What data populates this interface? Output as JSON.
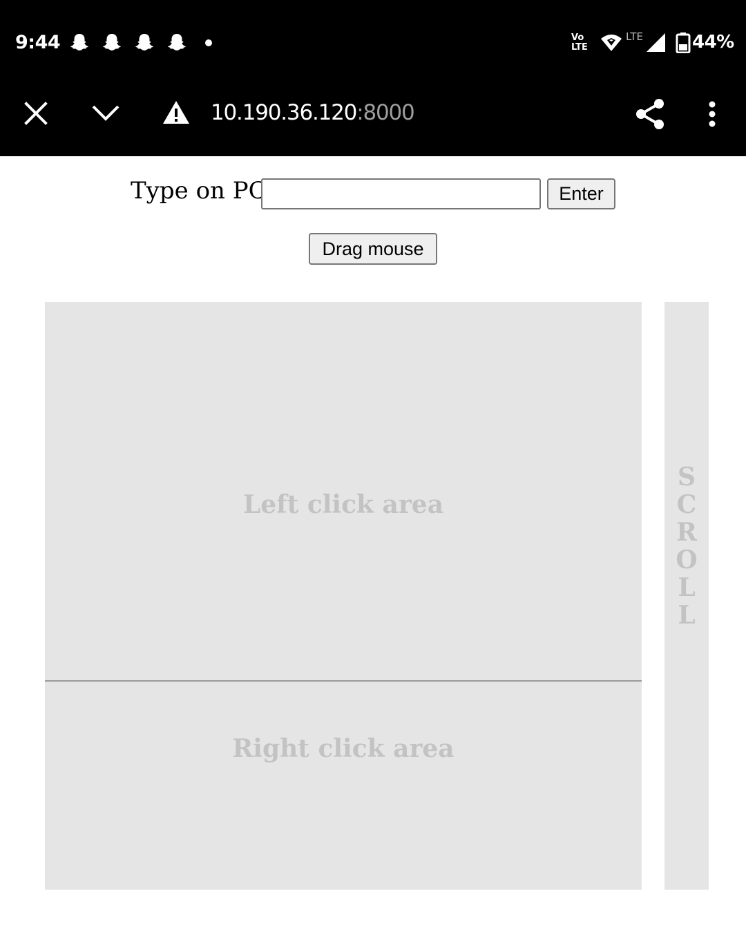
{
  "status_bar": {
    "time": "9:44",
    "notifications": [
      "snapchat-icon",
      "snapchat-icon",
      "snapchat-icon",
      "snapchat-icon"
    ],
    "volte": [
      "Vo",
      "LTE"
    ],
    "network_label": "LTE",
    "battery": "44%"
  },
  "browser": {
    "url_host": "10.190.36.120",
    "url_port": ":8000",
    "icons": [
      "close-icon",
      "chevron-down-icon",
      "warning-icon",
      "share-icon",
      "more-vert-icon"
    ]
  },
  "page": {
    "type_label": "Type on PC",
    "type_input_value": "",
    "enter_button": "Enter",
    "drag_button": "Drag mouse",
    "left_area_label": "Left click area",
    "right_area_label": "Right click area",
    "scroll_letters": [
      "S",
      "C",
      "R",
      "O",
      "L",
      "L"
    ]
  },
  "colors": {
    "status_bg": "#000000",
    "area_bg": "#e5e5e5",
    "area_text": "#c3c3c3",
    "url_port": "#9e9e9e"
  }
}
